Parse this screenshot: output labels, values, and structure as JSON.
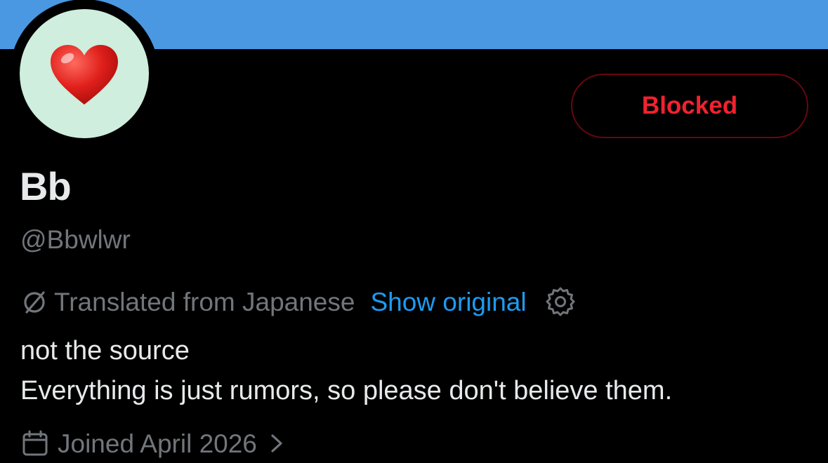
{
  "profile": {
    "display_name": "Bb",
    "handle": "@Bbwlwr",
    "avatar_icon": "red-heart-emoji",
    "banner_color": "#4a98e2",
    "avatar_bg_color": "#cfeedd"
  },
  "actions": {
    "blocked_label": "Blocked",
    "blocked_color": "#f4212e"
  },
  "translation": {
    "icon": "translate-icon",
    "label": "Translated from Japanese",
    "show_original_label": "Show original",
    "settings_icon": "gear-icon",
    "link_color": "#1d9bf0"
  },
  "bio": {
    "line1": "not the source",
    "line2": "Everything is just rumors, so please don't believe them."
  },
  "joined": {
    "icon": "calendar-icon",
    "label": "Joined April 2026",
    "chevron_icon": "chevron-right-icon"
  }
}
